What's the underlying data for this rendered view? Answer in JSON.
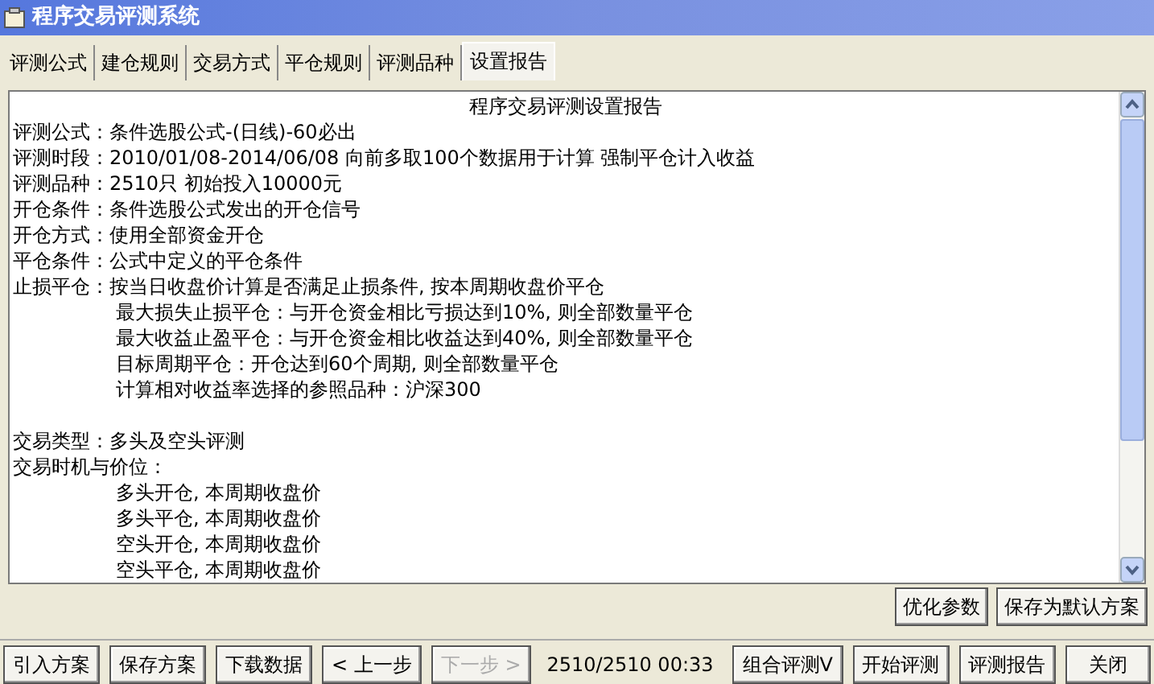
{
  "window": {
    "title": "程序交易评测系统"
  },
  "tabs": [
    {
      "label": "评测公式",
      "selected": false
    },
    {
      "label": "建仓规则",
      "selected": false
    },
    {
      "label": "交易方式",
      "selected": false
    },
    {
      "label": "平仓规则",
      "selected": false
    },
    {
      "label": "评测品种",
      "selected": false
    },
    {
      "label": "设置报告",
      "selected": true
    }
  ],
  "report": {
    "title": "程序交易评测设置报告",
    "lines": [
      {
        "kind": "field",
        "label": "评测公式：",
        "value": "条件选股公式-(日线)-60必出"
      },
      {
        "kind": "field",
        "label": "评测时段：",
        "value": "2010/01/08-2014/06/08 向前多取100个数据用于计算 强制平仓计入收益"
      },
      {
        "kind": "field",
        "label": "评测品种：",
        "value": "2510只 初始投入10000元"
      },
      {
        "kind": "field",
        "label": "开仓条件：",
        "value": "条件选股公式发出的开仓信号"
      },
      {
        "kind": "field",
        "label": "开仓方式：",
        "value": "使用全部资金开仓"
      },
      {
        "kind": "field",
        "label": "平仓条件：",
        "value": "公式中定义的平仓条件"
      },
      {
        "kind": "field",
        "label": "止损平仓：",
        "value": "按当日收盘价计算是否满足止损条件, 按本周期收盘价平仓"
      },
      {
        "kind": "indent",
        "value": "最大损失止损平仓：与开仓资金相比亏损达到10%, 则全部数量平仓"
      },
      {
        "kind": "indent",
        "value": "最大收益止盈平仓：与开仓资金相比收益达到40%, 则全部数量平仓"
      },
      {
        "kind": "indent",
        "value": "目标周期平仓：开仓达到60个周期, 则全部数量平仓"
      },
      {
        "kind": "indent",
        "value": "计算相对收益率选择的参照品种：沪深300"
      },
      {
        "kind": "gap"
      },
      {
        "kind": "field",
        "label": "交易类型：",
        "value": "多头及空头评测"
      },
      {
        "kind": "field",
        "label": "交易时机与价位："
      },
      {
        "kind": "indent",
        "value": "多头开仓, 本周期收盘价"
      },
      {
        "kind": "indent",
        "value": "多头平仓, 本周期收盘价"
      },
      {
        "kind": "indent",
        "value": "空头开仓, 本周期收盘价"
      },
      {
        "kind": "indent",
        "value": "空头平仓, 本周期收盘价"
      }
    ]
  },
  "side_buttons": [
    "优化参数",
    "保存为默认方案"
  ],
  "bottom_buttons": [
    {
      "label": "引入方案",
      "disabled": false
    },
    {
      "label": "保存方案",
      "disabled": false
    },
    {
      "label": "下载数据",
      "disabled": false
    },
    {
      "label": "< 上一步",
      "disabled": false
    },
    {
      "label": "下一步 >",
      "disabled": true
    }
  ],
  "status": "2510/2510  00:33",
  "right_buttons": [
    {
      "label": "组合评测V",
      "disabled": false
    },
    {
      "label": "开始评测",
      "disabled": false
    },
    {
      "label": "评测报告",
      "disabled": false
    },
    {
      "label": "关闭",
      "disabled": false
    }
  ]
}
